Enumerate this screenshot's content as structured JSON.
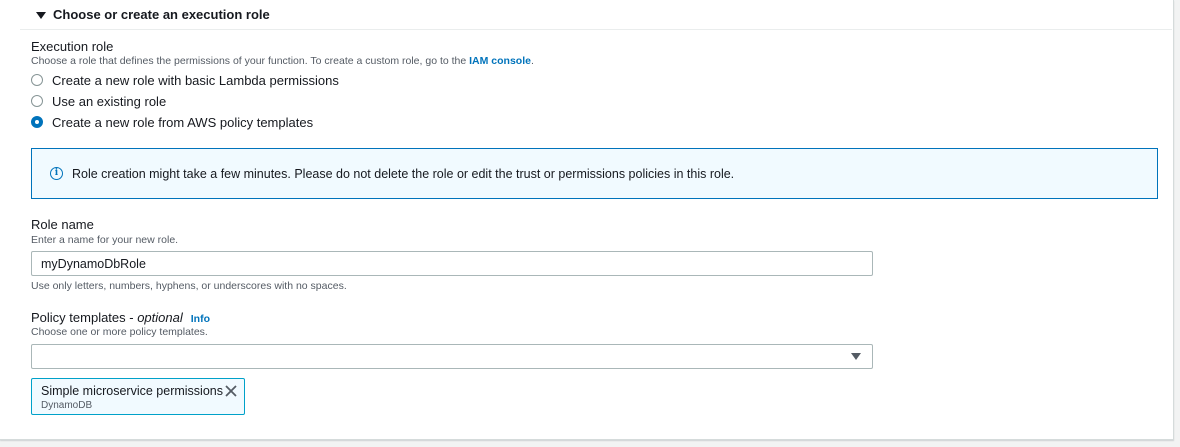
{
  "section": {
    "title": "Choose or create an execution role"
  },
  "execution_role": {
    "label": "Execution role",
    "description_prefix": "Choose a role that defines the permissions of your function. To create a custom role, go to the ",
    "description_link": "IAM console",
    "description_suffix": ".",
    "options": [
      {
        "label": "Create a new role with basic Lambda permissions",
        "checked": false
      },
      {
        "label": "Use an existing role",
        "checked": false
      },
      {
        "label": "Create a new role from AWS policy templates",
        "checked": true
      }
    ]
  },
  "alert": {
    "icon": "info-icon",
    "text": "Role creation might take a few minutes. Please do not delete the role or edit the trust or permissions policies in this role."
  },
  "role_name": {
    "label": "Role name",
    "description": "Enter a name for your new role.",
    "value": "myDynamoDbRole",
    "constraint": "Use only letters, numbers, hyphens, or underscores with no spaces."
  },
  "policy_templates": {
    "label": "Policy templates - ",
    "label_optional": "optional",
    "info_link": "Info",
    "description": "Choose one or more policy templates.",
    "selected_value": "",
    "tokens": [
      {
        "label": "Simple microservice permissions",
        "sublabel": "DynamoDB"
      }
    ]
  },
  "colors": {
    "accent": "#0073bb",
    "info_bg": "#f1faff",
    "token_border": "#00a1c9"
  }
}
